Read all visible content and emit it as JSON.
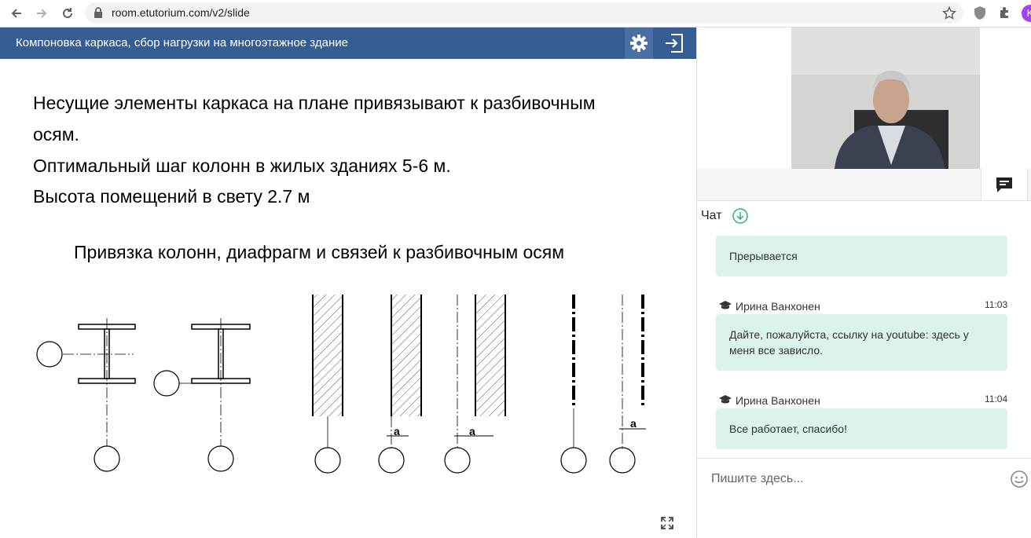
{
  "browser": {
    "url": "room.etutorium.com/v2/slide",
    "profile_initial": "K"
  },
  "slide": {
    "title": "Компоновка каркаса, сбор нагрузки на многоэтажное здание",
    "lines": [
      "Несущие элементы каркаса на плане привязывают к разбивочным",
      "осям.",
      "Оптимальный шаг колонн в жилых зданиях 5-6 м.",
      "Высота помещений в свету 2.7 м"
    ],
    "subtitle": "Привязка колонн, диафрагм и связей к разбивочным осям",
    "dimension_label": "a"
  },
  "chat": {
    "title": "Чат",
    "messages": [
      {
        "author": "",
        "time": "",
        "text": "Прерывается"
      },
      {
        "author": "Ирина Ванхонен",
        "time": "11:03",
        "text": "Дайте, пожалуйста, ссылку на youtube: здесь у меня все зависло."
      },
      {
        "author": "Ирина Ванхонен",
        "time": "11:04",
        "text": "Все работает, спасибо!"
      }
    ],
    "input_placeholder": "Пишите здесь..."
  },
  "colors": {
    "header_bg": "#355c93",
    "bubble_bg": "#dcf3ec",
    "accent_green": "#2ab27b",
    "profile_purple": "#a142f4"
  }
}
